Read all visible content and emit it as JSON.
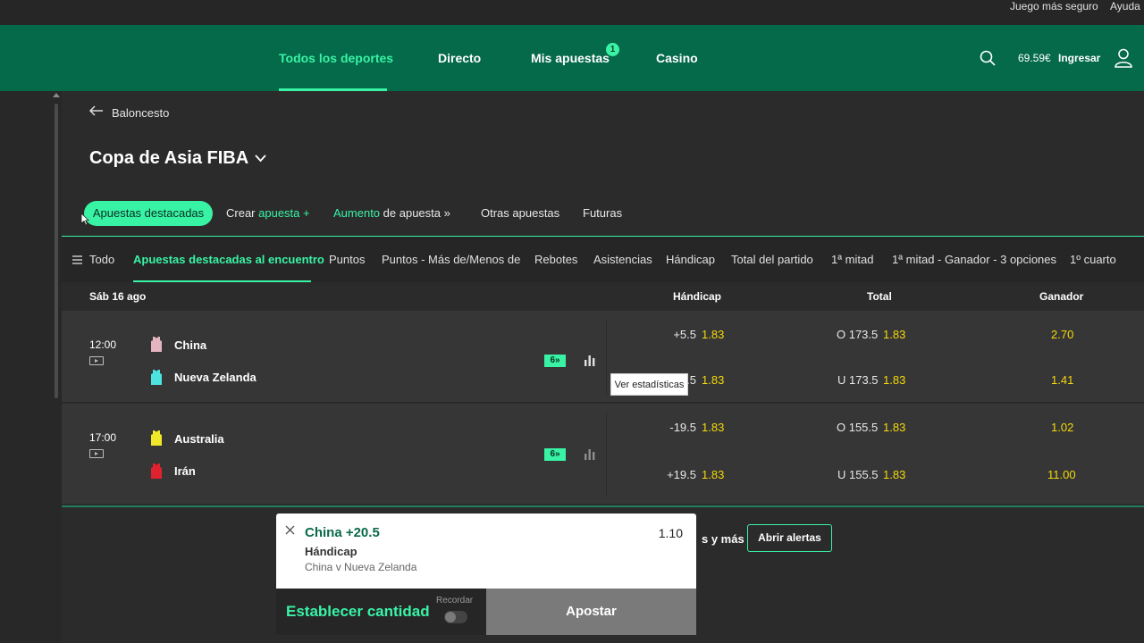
{
  "utility": {
    "safer_gambling": "Juego más seguro",
    "help": "Ayuda"
  },
  "header": {
    "nav": [
      {
        "label": "Todos los deportes",
        "active": true
      },
      {
        "label": "Directo",
        "active": false
      },
      {
        "label": "Mis apuestas",
        "active": false,
        "badge": "1"
      },
      {
        "label": "Casino",
        "active": false
      }
    ],
    "balance": "69.59€",
    "login": "Ingresar"
  },
  "breadcrumb": {
    "back_label": "Baloncesto"
  },
  "competition": {
    "title": "Copa de Asia FIBA"
  },
  "subtabs": {
    "featured": "Apuestas destacadas",
    "create_a": "Crear ",
    "create_b": "apuesta +",
    "boost_a": "Aumento",
    "boost_b": " de apuesta »",
    "other": "Otras apuestas",
    "futures": "Futuras"
  },
  "markets": [
    {
      "label": "Todo",
      "active": false
    },
    {
      "label": "Apuestas destacadas al encuentro",
      "active": true
    },
    {
      "label": "Puntos",
      "active": false
    },
    {
      "label": "Puntos - Más de/Menos de",
      "active": false
    },
    {
      "label": "Rebotes",
      "active": false
    },
    {
      "label": "Asistencias",
      "active": false
    },
    {
      "label": "Hándicap",
      "active": false
    },
    {
      "label": "Total del partido",
      "active": false
    },
    {
      "label": "1ª mitad",
      "active": false
    },
    {
      "label": "1ª mitad - Ganador - 3 opciones",
      "active": false
    },
    {
      "label": "1º cuarto",
      "active": false
    }
  ],
  "table": {
    "date": "Sáb 16 ago",
    "col_handicap": "Hándicap",
    "col_total": "Total",
    "col_winner": "Ganador"
  },
  "events": [
    {
      "time": "12:00",
      "bet_builder": "6",
      "teams": [
        {
          "name": "China",
          "jersey_color": "#e4b4c0",
          "handicap_line": "+5.5",
          "handicap_odd": "1.83",
          "total_line": "O 173.5",
          "total_odd": "1.83",
          "winner_odd": "2.70"
        },
        {
          "name": "Nueva Zelanda",
          "jersey_color": "#4de3e0",
          "handicap_line": "-5.5",
          "handicap_odd": "1.83",
          "total_line": "U 173.5",
          "total_odd": "1.83",
          "winner_odd": "1.41"
        }
      ]
    },
    {
      "time": "17:00",
      "bet_builder": "6",
      "teams": [
        {
          "name": "Australia",
          "jersey_color": "#f0e92a",
          "handicap_line": "-19.5",
          "handicap_odd": "1.83",
          "total_line": "O 155.5",
          "total_odd": "1.83",
          "winner_odd": "1.02"
        },
        {
          "name": "Irán",
          "jersey_color": "#e0222e",
          "handicap_line": "+19.5",
          "handicap_odd": "1.83",
          "total_line": "U 155.5",
          "total_odd": "1.83",
          "winner_odd": "11.00"
        }
      ]
    }
  ],
  "tooltip": "Ver estadísticas",
  "alerts": {
    "text": "s y más",
    "button": "Abrir alertas"
  },
  "betslip": {
    "selection": "China +20.5",
    "odds": "1.10",
    "market": "Hándicap",
    "event": "China v Nueva Zelanda",
    "stake_label": "Establecer cantidad",
    "remember": "Recordar",
    "place_bet": "Apostar"
  },
  "colors": {
    "brand_green": "#046a49",
    "accent": "#39f3a5",
    "odds_yellow": "#f5d90a"
  }
}
